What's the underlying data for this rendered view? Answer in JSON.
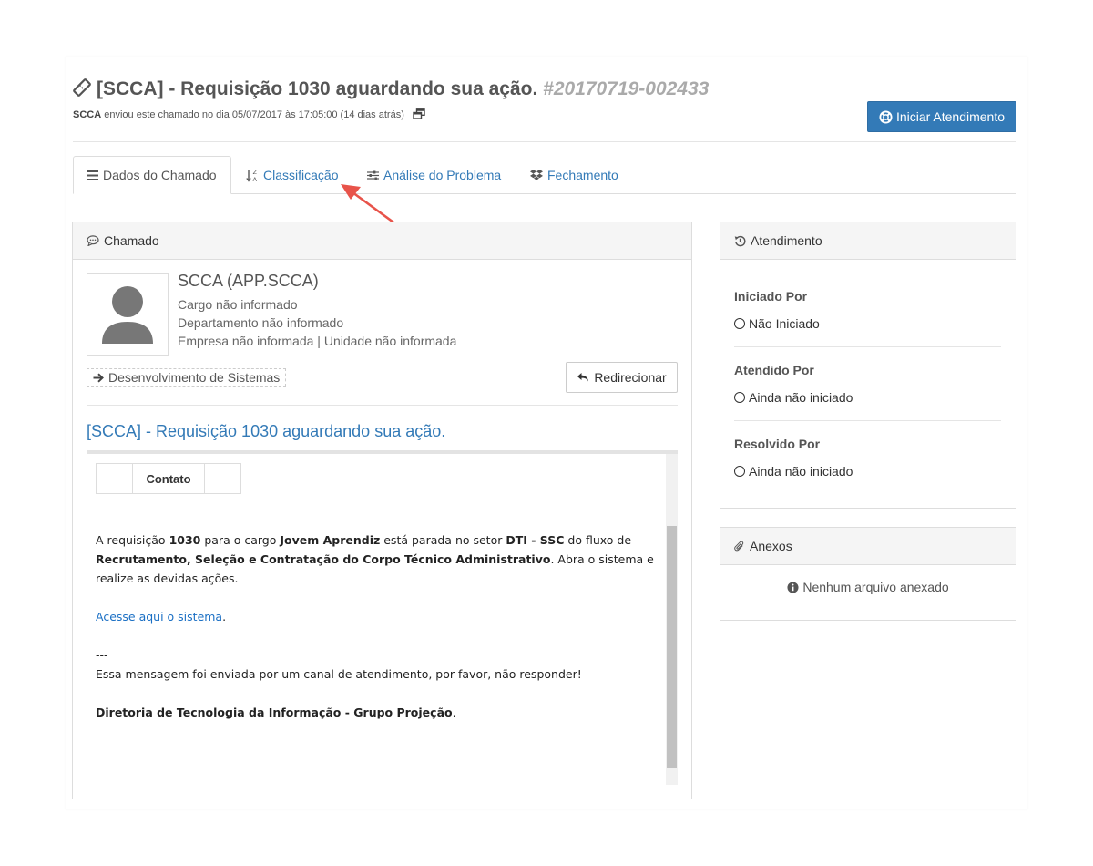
{
  "header": {
    "title": "[SCCA] - Requisição 1030 aguardando sua ação.",
    "ticket_number": "#20170719-002433",
    "sender": "SCCA",
    "sent_info": "enviou este chamado no dia 05/07/2017 às 17:05:00 (14 dias atrás)",
    "start_button": "Iniciar Atendimento",
    "accent_color": "#337ab7"
  },
  "tabs": [
    {
      "label": "Dados do Chamado",
      "icon": "list-icon",
      "active": true
    },
    {
      "label": "Classificação",
      "icon": "sort-alpha-icon",
      "active": false
    },
    {
      "label": "Análise do Problema",
      "icon": "sliders-icon",
      "active": false
    },
    {
      "label": "Fechamento",
      "icon": "dropbox-icon",
      "active": false
    }
  ],
  "chamado": {
    "panel_title": "Chamado",
    "user_name": "SCCA (APP.SCCA)",
    "cargo": "Cargo não informado",
    "departamento": "Departamento não informado",
    "empresa": "Empresa não informada | Unidade não informada",
    "department_tag": "Desenvolvimento de Sistemas",
    "redirect_button": "Redirecionar",
    "subject": "[SCCA] - Requisição 1030 aguardando sua ação.",
    "email": {
      "table_header": "Contato",
      "p1_a": "A requisição ",
      "p1_num": "1030",
      "p1_b": " para o cargo ",
      "p1_cargo": "Jovem Aprendiz",
      "p1_c": " está parada no setor ",
      "p1_setor": "DTI - SSC",
      "p1_d": " do fluxo de ",
      "p1_fluxo": "Recrutamento, Seleção e Contratação do Corpo Técnico Administrativo",
      "p1_e": ". Abra o sistema e realize as devidas ações.",
      "link": "Acesse aqui o sistema",
      "link_dot": ".",
      "separator": "---",
      "footer_note": "Essa mensagem foi enviada por um canal de atendimento, por favor, não responder!",
      "signature": "Diretoria de Tecnologia da Informação - Grupo Projeção",
      "signature_dot": "."
    }
  },
  "atendimento": {
    "panel_title": "Atendimento",
    "iniciado_label": "Iniciado Por",
    "iniciado_value": "Não Iniciado",
    "atendido_label": "Atendido Por",
    "atendido_value": "Ainda não iniciado",
    "resolvido_label": "Resolvido Por",
    "resolvido_value": "Ainda não iniciado"
  },
  "anexos": {
    "panel_title": "Anexos",
    "empty_text": "Nenhum arquivo anexado"
  },
  "annotation_arrow_color": "#e8534a"
}
